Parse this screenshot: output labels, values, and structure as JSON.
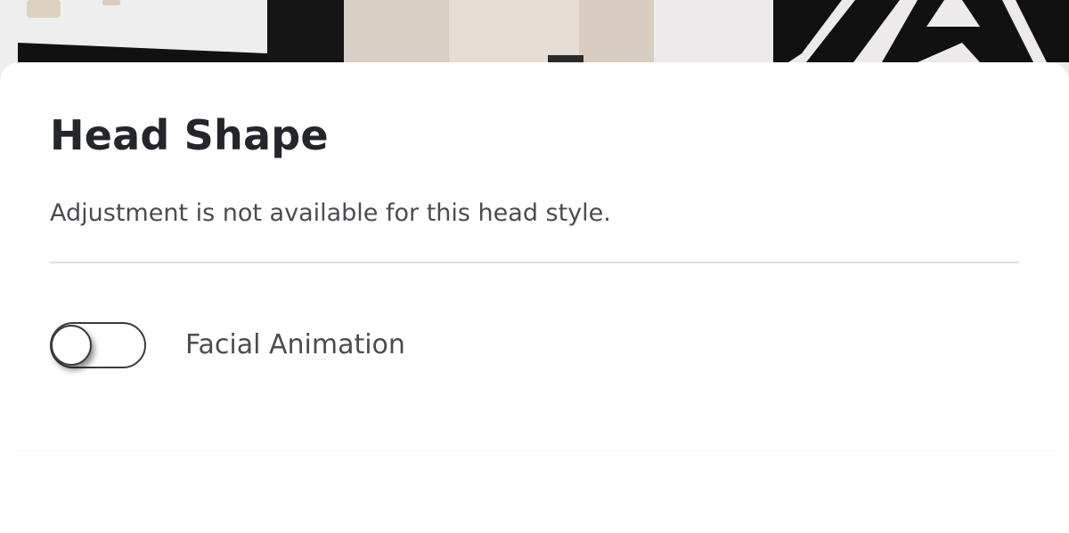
{
  "panel": {
    "title": "Head Shape",
    "subtitle": "Adjustment is not available for this head style."
  },
  "facial_animation": {
    "label": "Facial Animation",
    "enabled": false
  },
  "colors": {
    "sheet_background": "#ffffff",
    "title_text": "#24262b",
    "body_text": "#4a4c52",
    "divider": "#e1e1e3",
    "toggle_outline": "#393b3f"
  }
}
